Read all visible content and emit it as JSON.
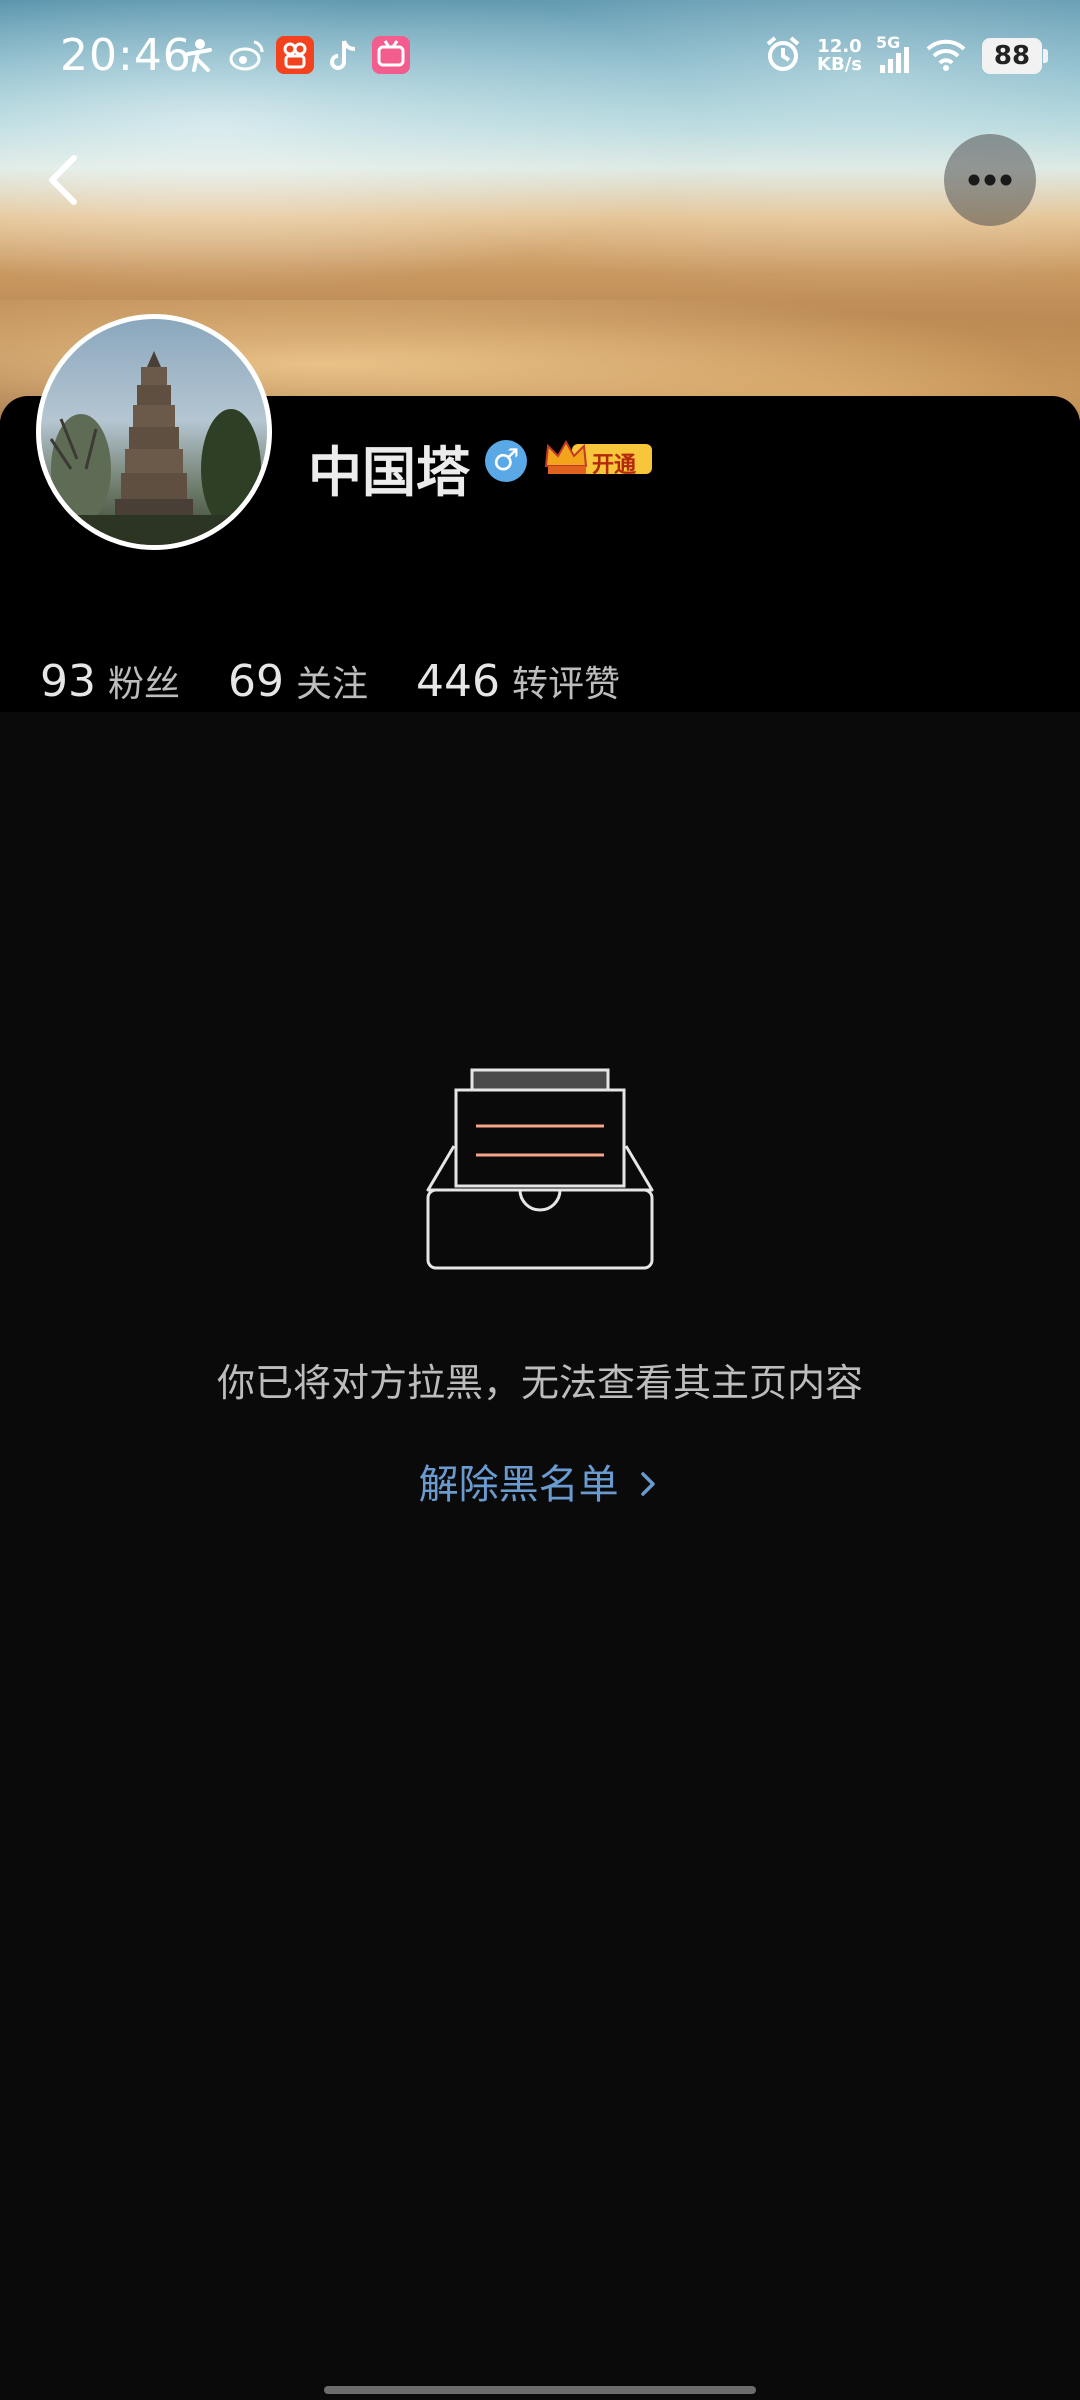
{
  "status_bar": {
    "time": "20:46",
    "net_speed_value": "12.0",
    "net_speed_unit": "KB/s",
    "network": "5G",
    "battery": "88"
  },
  "profile": {
    "name": "中国塔",
    "gender_icon": "male-icon",
    "vip_label": "开通",
    "stats": [
      {
        "value": "93",
        "label": "粉丝"
      },
      {
        "value": "69",
        "label": "关注"
      },
      {
        "value": "446",
        "label": "转评赞"
      }
    ]
  },
  "empty_state": {
    "message": "你已将对方拉黑，无法查看其主页内容",
    "action_label": "解除黑名单"
  },
  "colors": {
    "background": "#0a0a0a",
    "card": "#000000",
    "link": "#6a9bd0",
    "accent_line": "#f4a58a"
  }
}
